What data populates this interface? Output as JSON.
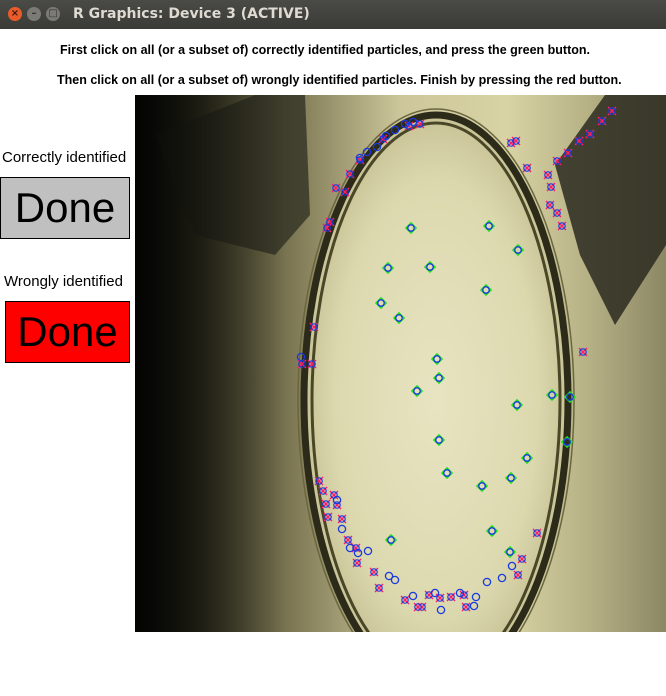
{
  "window": {
    "title": "R Graphics: Device 3 (ACTIVE)",
    "close_glyph": "×",
    "min_glyph": "–",
    "max_glyph": "□"
  },
  "instructions": {
    "line1": "First click on all (or a subset of) correctly identified particles, and press the green button.",
    "line2": "Then click on all (or a subset of) wrongly identified particles. Finish by pressing the red button."
  },
  "correct": {
    "label": "Correctly identified",
    "button_label": "Done",
    "button_color": "#c0c0c0"
  },
  "wrong": {
    "label": "Wrongly identified",
    "button_label": "Done",
    "button_color": "#ff0000"
  },
  "colors": {
    "correct_marker": "#22dd22",
    "detected_circle": "#1a3adf",
    "wrong_marker": "#ff1a6a"
  }
}
